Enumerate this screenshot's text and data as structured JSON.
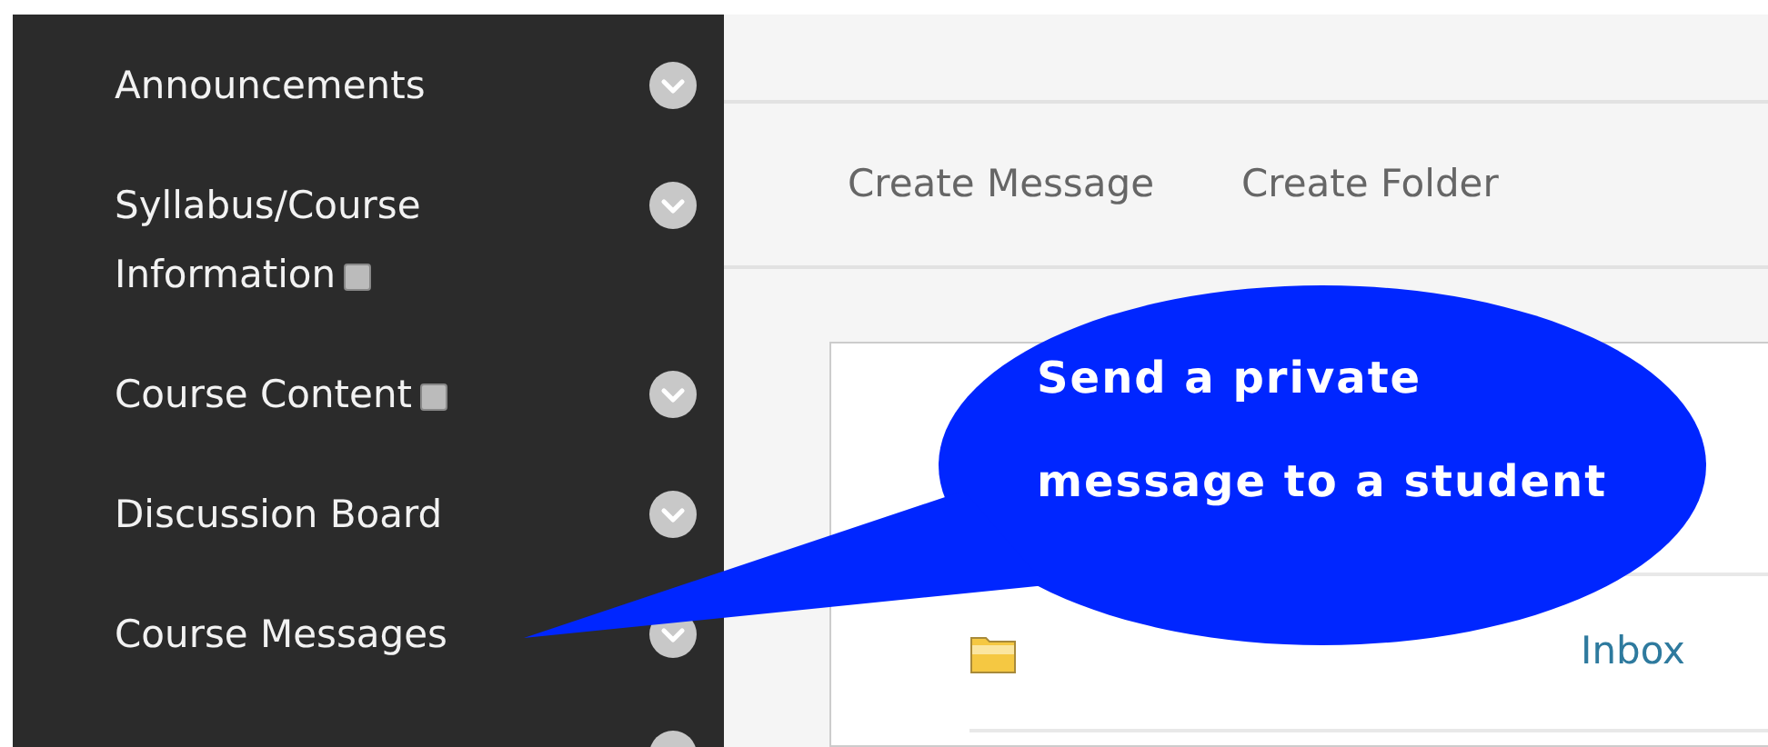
{
  "sidebar": {
    "items": [
      {
        "label": "Announcements",
        "badge": false
      },
      {
        "label": "Syllabus/Course Information",
        "badge": true
      },
      {
        "label": "Course Content",
        "badge": true
      },
      {
        "label": "Discussion Board",
        "badge": false
      },
      {
        "label": "Course Messages",
        "badge": false
      },
      {
        "badge": false
      }
    ]
  },
  "toolbar": {
    "actions": [
      "Create Message",
      "Create Folder"
    ]
  },
  "folders": {
    "rows": [
      {
        "name": "Inbox"
      }
    ]
  },
  "callout": {
    "text": "Send a private\nmessage to a student"
  }
}
